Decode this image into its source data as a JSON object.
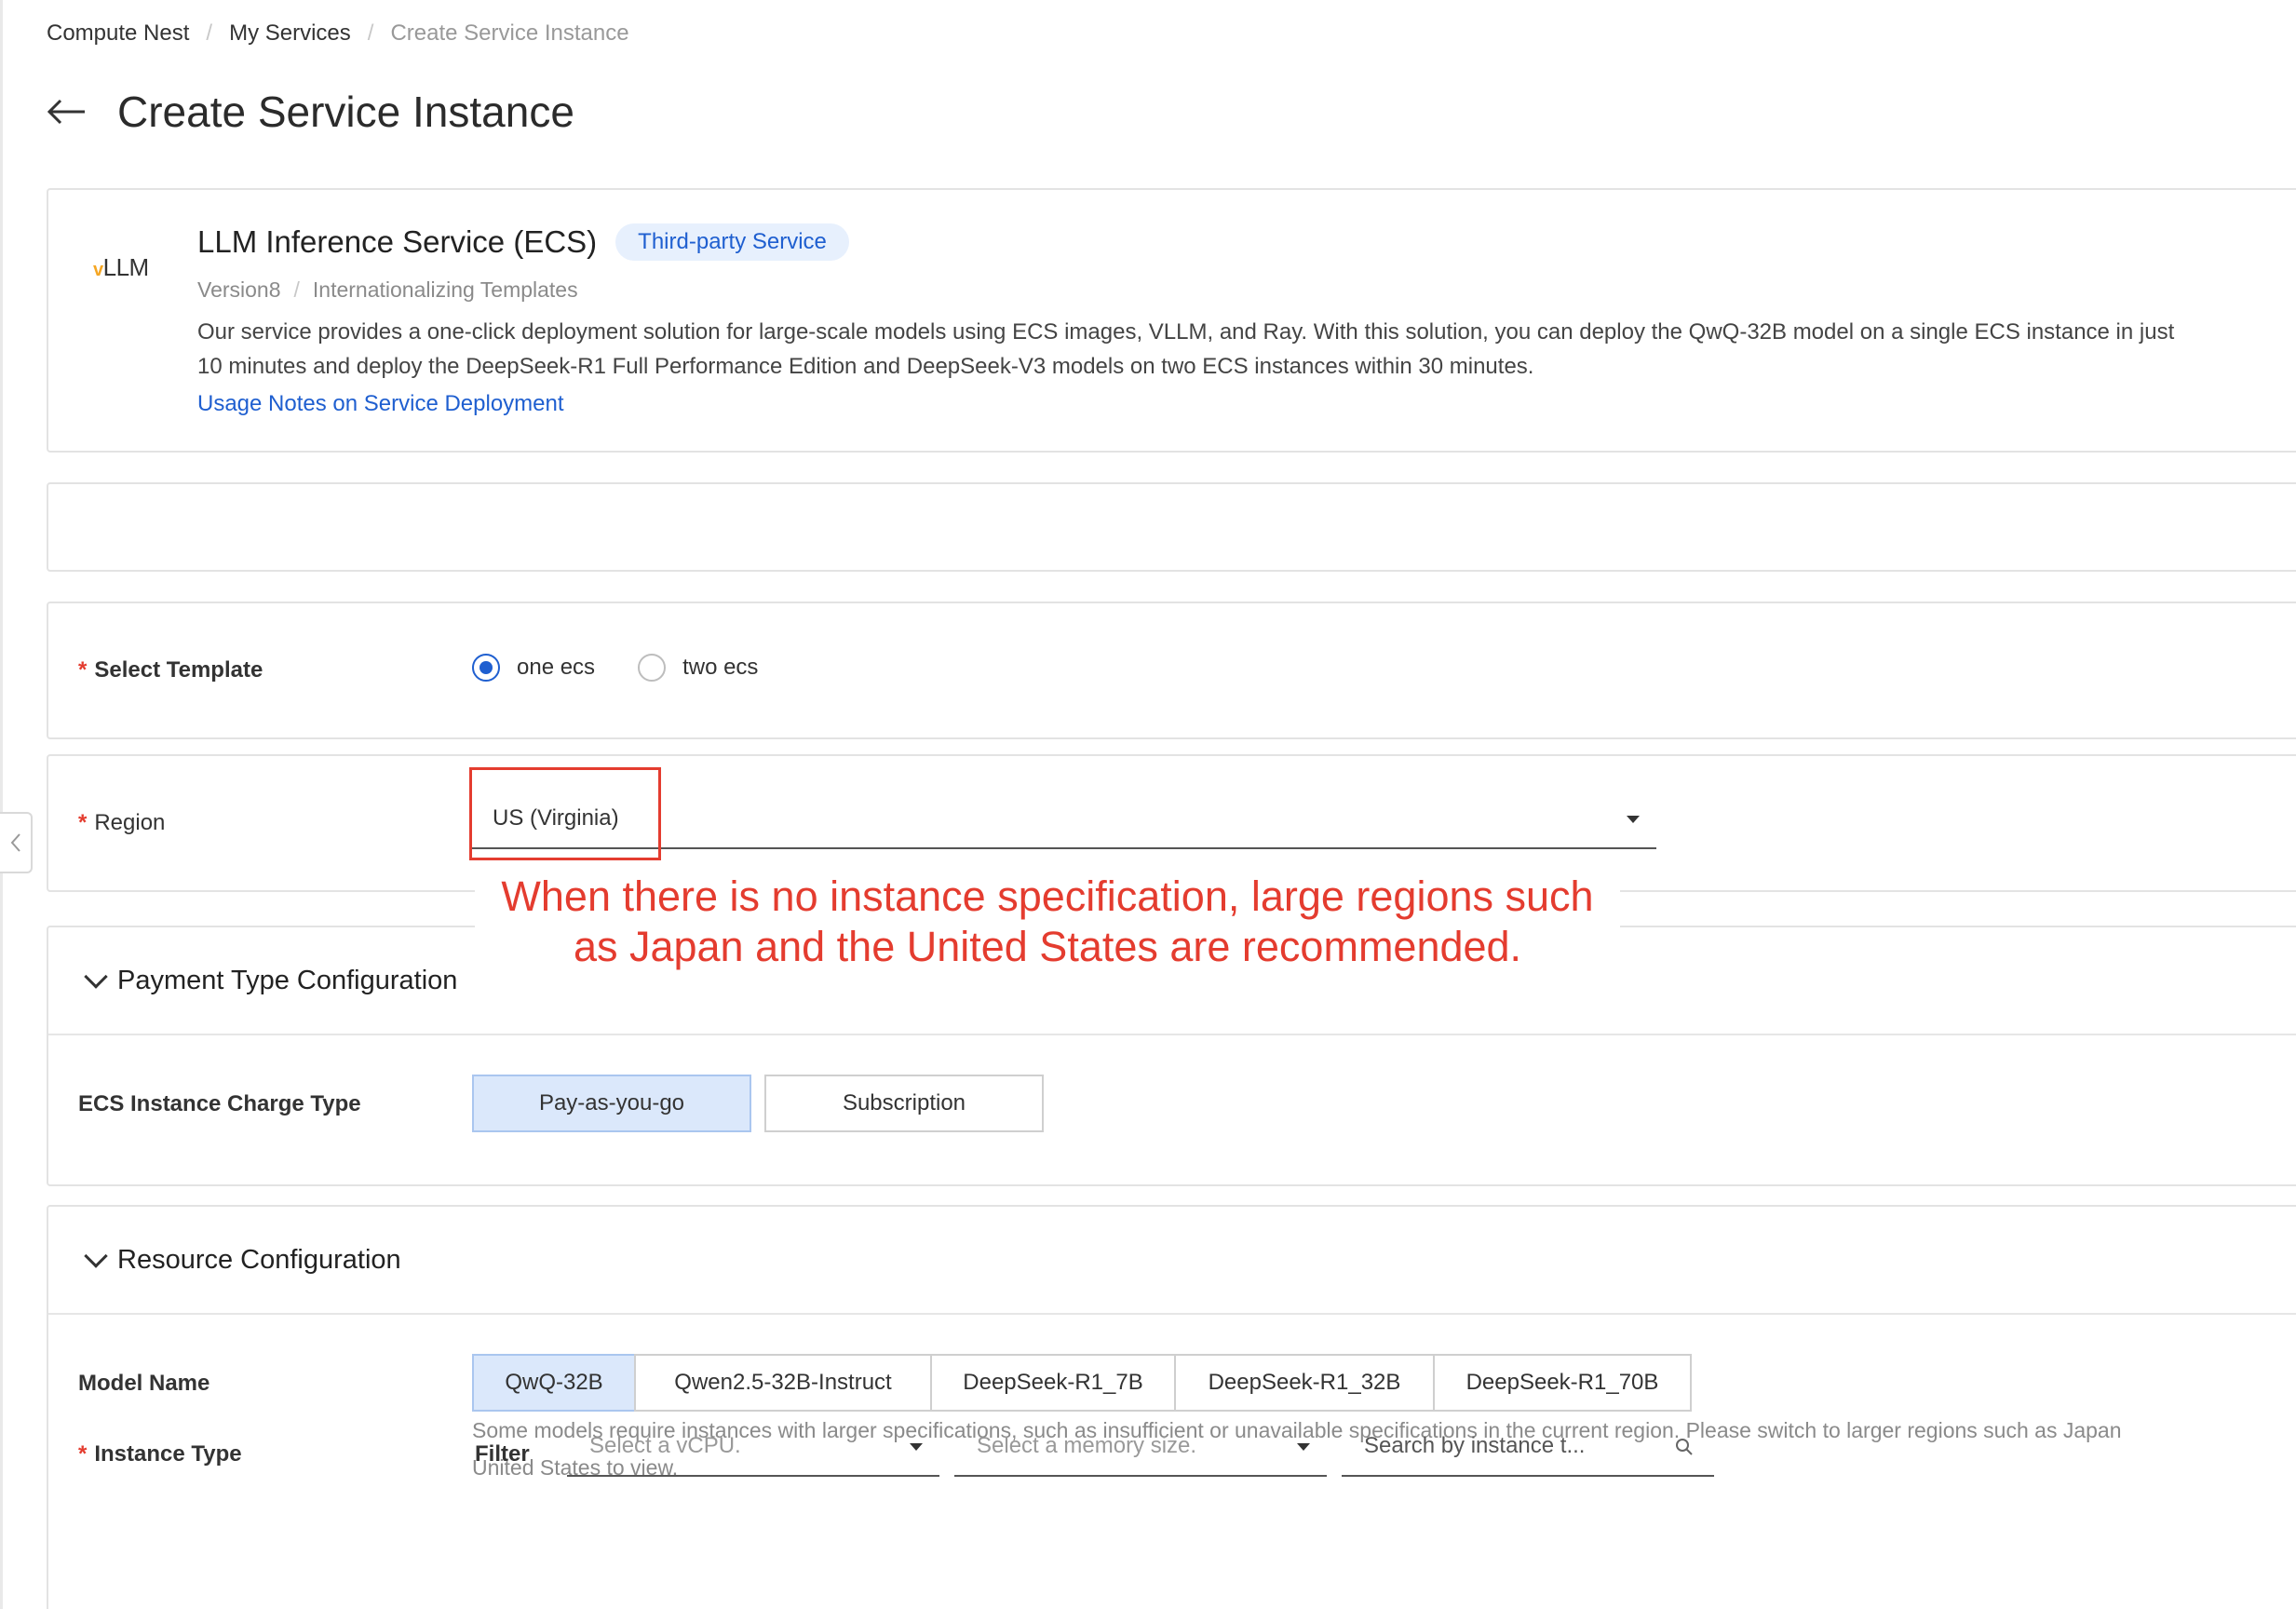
{
  "breadcrumb": [
    "Compute Nest",
    "My Services",
    "Create Service Instance"
  ],
  "page": {
    "title": "Create Service Instance"
  },
  "service": {
    "logo_text": "LLM",
    "name": "LLM Inference Service (ECS)",
    "badge": "Third-party Service",
    "version": "Version8",
    "template": "Internationalizing Templates",
    "description_line1": "Our service provides a one-click deployment solution for large-scale models using ECS images, VLLM, and Ray. With this solution, you can deploy the QwQ-32B model on a single ECS instance in just",
    "description_line2": "10 minutes and deploy the DeepSeek-R1 Full Performance Edition and DeepSeek-V3 models on two ECS instances within 30 minutes.",
    "link": "Usage Notes on Service Deployment"
  },
  "template_field": {
    "label": "Select Template",
    "options": [
      "one ecs",
      "two ecs"
    ],
    "selected": "one ecs"
  },
  "region_field": {
    "label": "Region",
    "value": "US (Virginia)"
  },
  "annotation": {
    "line1": "When there is no instance specification, large regions such",
    "line2": "as Japan and the United States are recommended."
  },
  "payment": {
    "section_title": "Payment Type Configuration",
    "label": "ECS Instance Charge Type",
    "options": [
      "Pay-as-you-go",
      "Subscription"
    ],
    "selected": "Pay-as-you-go"
  },
  "resource": {
    "section_title": "Resource Configuration",
    "model_label": "Model Name",
    "models": [
      "QwQ-32B",
      "Qwen2.5-32B-Instruct",
      "DeepSeek-R1_7B",
      "DeepSeek-R1_32B",
      "DeepSeek-R1_70B"
    ],
    "selected_model": "QwQ-32B",
    "hint_line1": "Some models require instances with larger specifications, such as insufficient or unavailable specifications in the current region. Please switch to larger regions such as Japan",
    "hint_line2": "United States to view.",
    "instance_label": "Instance Type",
    "filter_label": "Filter",
    "vcpu_placeholder": "Select a vCPU.",
    "memory_placeholder": "Select a memory size.",
    "search_placeholder": "Search by instance t..."
  },
  "colors": {
    "accent": "#1f5fd0",
    "required": "#e43c2f",
    "selected_bg": "#dbe8fb"
  }
}
